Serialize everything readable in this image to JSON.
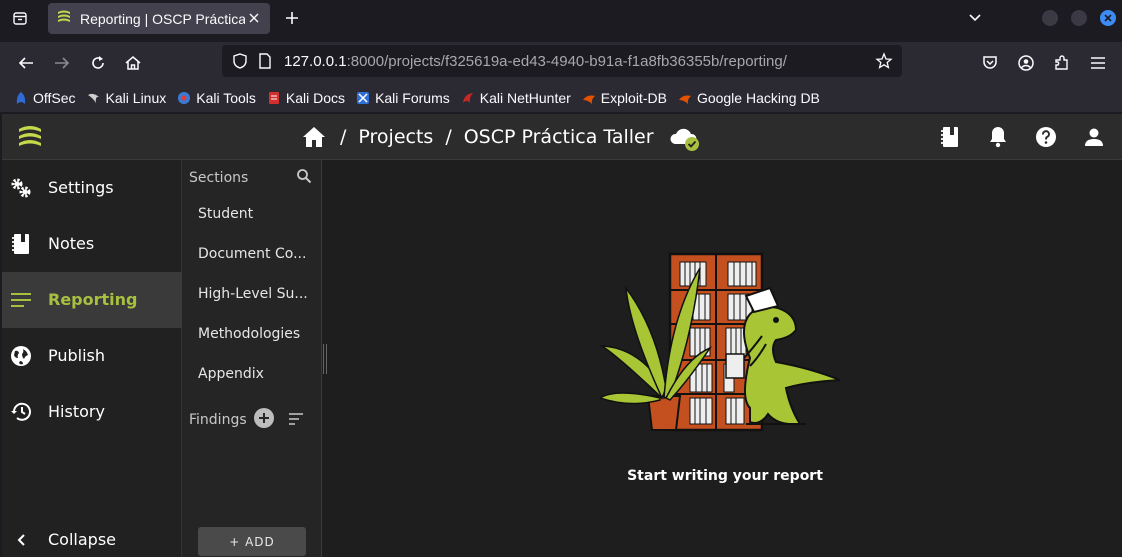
{
  "browser": {
    "tab_title": "Reporting | OSCP Práctica",
    "url_host": "127.0.0.1",
    "url_rest": ":8000/projects/f325619a-ed43-4940-b91a-f1a8fb36355b/reporting/",
    "bookmarks": [
      {
        "label": "OffSec",
        "icon": "offsec-icon",
        "color": "#2e6bd6"
      },
      {
        "label": "Kali Linux",
        "icon": "kali-dragon-icon",
        "color": "#cfcfcf"
      },
      {
        "label": "Kali Tools",
        "icon": "kali-tools-icon",
        "color": "#3a7bd5"
      },
      {
        "label": "Kali Docs",
        "icon": "kali-docs-icon",
        "color": "#d32f2f"
      },
      {
        "label": "Kali Forums",
        "icon": "kali-forums-icon",
        "color": "#2f6fd6"
      },
      {
        "label": "Kali NetHunter",
        "icon": "nethunter-icon",
        "color": "#c62828"
      },
      {
        "label": "Exploit-DB",
        "icon": "exploit-db-icon",
        "color": "#e65100"
      },
      {
        "label": "Google Hacking DB",
        "icon": "ghdb-icon",
        "color": "#e65100"
      }
    ]
  },
  "app": {
    "accent": "#a7c03f",
    "breadcrumb": {
      "projects": "Projects",
      "project_name": "OSCP Práctica Taller",
      "separator": "/"
    },
    "nav": [
      {
        "label": "Settings",
        "icon": "settings-icon"
      },
      {
        "label": "Notes",
        "icon": "notes-icon"
      },
      {
        "label": "Reporting",
        "icon": "reporting-icon",
        "active": true
      },
      {
        "label": "Publish",
        "icon": "publish-icon"
      },
      {
        "label": "History",
        "icon": "history-icon"
      }
    ],
    "collapse_label": "Collapse",
    "sections": {
      "header": "Sections",
      "items": [
        "Student",
        "Document Co...",
        "High-Level Su...",
        "Methodologies",
        "Appendix"
      ],
      "findings_label": "Findings",
      "add_label": "+ ADD"
    },
    "main": {
      "empty_text": "Start writing your report"
    }
  }
}
